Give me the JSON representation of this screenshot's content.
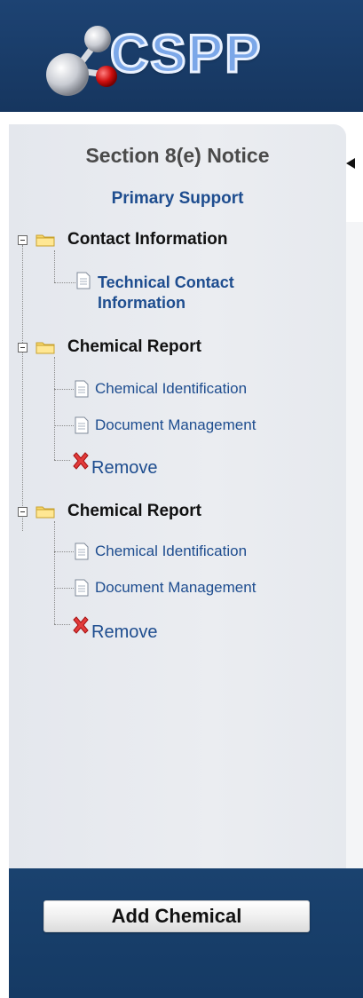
{
  "header": {
    "logo_text": "CSPP"
  },
  "nav": {
    "section_title": "Section 8(e) Notice",
    "primary_support": "Primary Support",
    "contact": {
      "label": "Contact Information",
      "children": [
        {
          "label": "Technical Contact Information"
        }
      ]
    },
    "chemical_reports": [
      {
        "label": "Chemical Report",
        "children": [
          {
            "label": "Chemical Identification"
          },
          {
            "label": "Document Management"
          }
        ],
        "remove_label": "Remove"
      },
      {
        "label": "Chemical Report",
        "children": [
          {
            "label": "Chemical Identification"
          },
          {
            "label": "Document Management"
          }
        ],
        "remove_label": "Remove"
      }
    ]
  },
  "footer": {
    "add_chemical_label": "Add Chemical"
  },
  "colors": {
    "header_bg": "#1d4373",
    "link": "#1e4d8f",
    "panel_bg": "#e9ebef"
  }
}
